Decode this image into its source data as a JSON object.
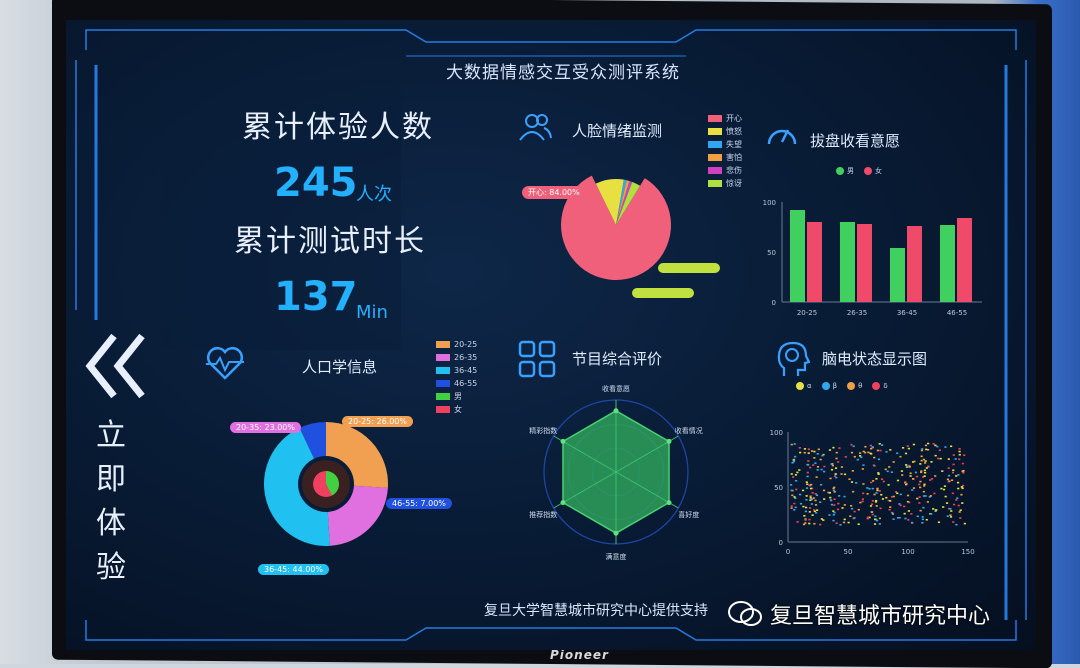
{
  "title": "大数据情感交互受众测评系统",
  "stats": {
    "visitors_label": "累计体验人数",
    "visitors_value": "245",
    "visitors_unit": "人次",
    "duration_label": "累计测试时长",
    "duration_value": "137",
    "duration_unit": "Min"
  },
  "side_button": {
    "chars": [
      "立",
      "即",
      "体",
      "验"
    ]
  },
  "emotion_panel": {
    "title": "人脸情绪监测",
    "legend": [
      {
        "label": "开心",
        "color": "#f0607a"
      },
      {
        "label": "愤怒",
        "color": "#e8e040"
      },
      {
        "label": "失望",
        "color": "#30a8f0"
      },
      {
        "label": "害怕",
        "color": "#f0a040"
      },
      {
        "label": "悲伤",
        "color": "#d040c0"
      },
      {
        "label": "惊讶",
        "color": "#b0e040"
      }
    ],
    "callout": "开心: 84.00%",
    "chart_data": {
      "type": "pie",
      "labels": [
        "开心",
        "愤怒",
        "失望",
        "害怕",
        "悲伤",
        "惊讶"
      ],
      "values": [
        84,
        10,
        1,
        1,
        1,
        3
      ]
    }
  },
  "willingness_panel": {
    "title": "拔盘收看意愿",
    "legend": [
      {
        "label": "男",
        "color": "#40d060"
      },
      {
        "label": "女",
        "color": "#f04a6a"
      }
    ],
    "chart_data": {
      "type": "bar",
      "categories": [
        "20-25",
        "26-35",
        "36-45",
        "46-55"
      ],
      "series": [
        {
          "name": "男",
          "values": [
            92,
            80,
            54,
            77
          ]
        },
        {
          "name": "女",
          "values": [
            80,
            78,
            76,
            84
          ]
        }
      ],
      "ylim": [
        0,
        100
      ],
      "yticks": [
        "0",
        "50",
        "100"
      ]
    }
  },
  "demographics_panel": {
    "title": "人口学信息",
    "legend": [
      {
        "label": "20-25",
        "color": "#f0a050"
      },
      {
        "label": "26-35",
        "color": "#e070e0"
      },
      {
        "label": "36-45",
        "color": "#20c0f0"
      },
      {
        "label": "46-55",
        "color": "#2050e0"
      },
      {
        "label": "男",
        "color": "#40d040"
      },
      {
        "label": "女",
        "color": "#f04060"
      }
    ],
    "callouts": [
      "20-35: 23.00%",
      "20-25: 26.00%",
      "46-55: 7.00%",
      "36-45: 44.00%"
    ],
    "chart_data": {
      "type": "pie",
      "labels": [
        "20-25",
        "26-35",
        "36-45",
        "46-55"
      ],
      "values": [
        26,
        23,
        44,
        7
      ]
    }
  },
  "rating_panel": {
    "title": "节目综合评价",
    "axes": [
      "收看意愿",
      "收看情况",
      "喜好度",
      "满意度",
      "推荐指数",
      "精彩指数"
    ],
    "chart_data": {
      "type": "radar",
      "labels": [
        "收看意愿",
        "收看情况",
        "喜好度",
        "满意度",
        "推荐指数",
        "精彩指数"
      ],
      "values": [
        0.85,
        0.85,
        0.85,
        0.85,
        0.85,
        0.85
      ]
    }
  },
  "eeg_panel": {
    "title": "脑电状态显示图",
    "legend": [
      {
        "label": "α",
        "color": "#e8e040"
      },
      {
        "label": "β",
        "color": "#30a8f0"
      },
      {
        "label": "θ",
        "color": "#f0a040"
      },
      {
        "label": "δ",
        "color": "#f0405a"
      }
    ],
    "chart_data": {
      "type": "scatter",
      "xlim": [
        0,
        150
      ],
      "ylim": [
        0,
        100
      ],
      "xticks": [
        "0",
        "50",
        "100",
        "150"
      ],
      "yticks": [
        "0",
        "50",
        "100"
      ]
    }
  },
  "footer": "复旦大学智慧城市研究中心提供支持",
  "brand": "Pioneer",
  "watermark": "复旦智慧城市研究中心"
}
